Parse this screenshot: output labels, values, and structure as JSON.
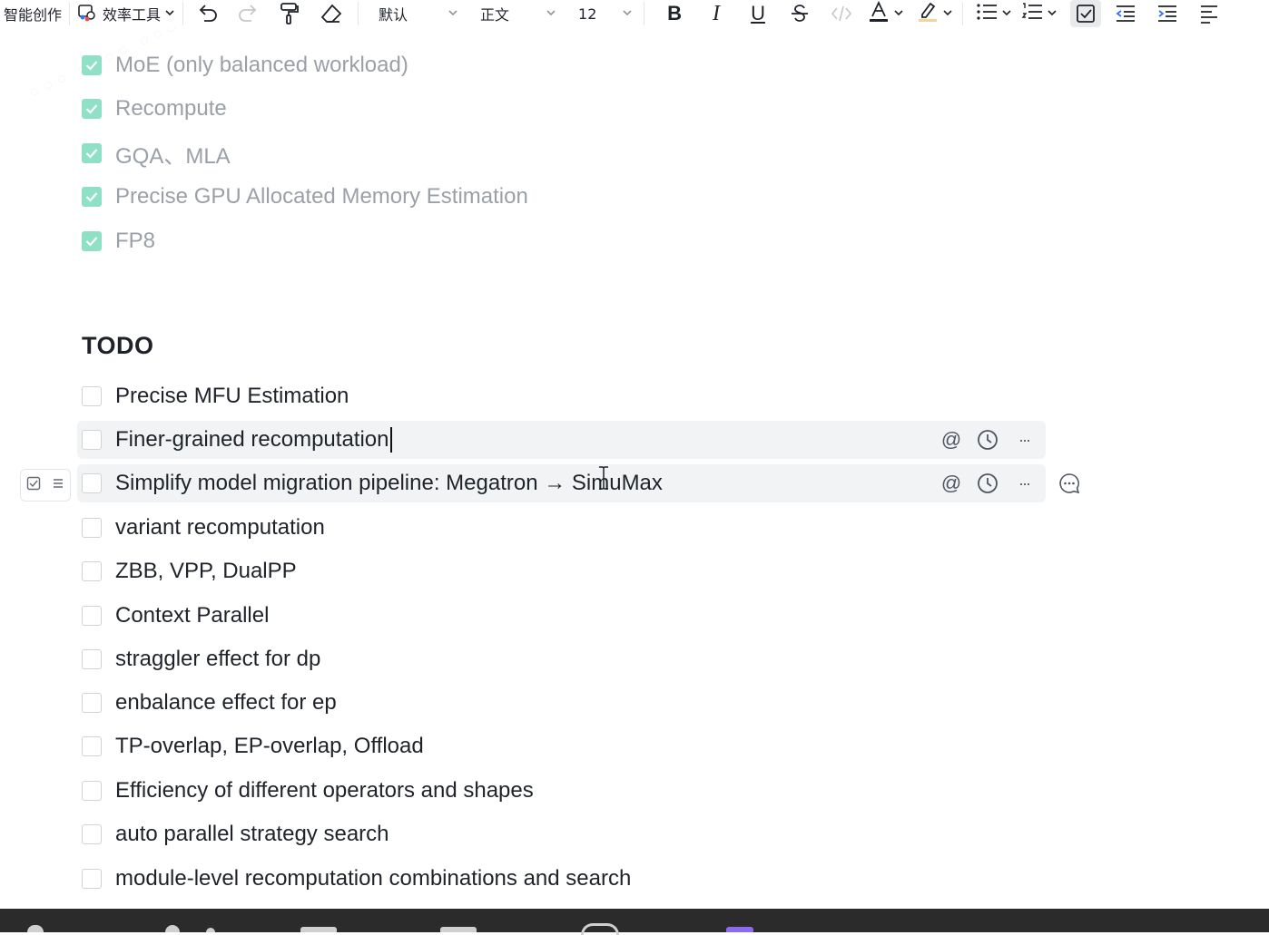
{
  "toolbar": {
    "ai_create": "智能创作",
    "efficiency_tools": "效率工具",
    "font_family": "默认",
    "paragraph_style": "正文",
    "font_size": "12",
    "bold": "B",
    "italic": "I",
    "underline": "U",
    "icons": [
      "undo-icon",
      "redo-icon",
      "format-painter-icon",
      "eraser-icon",
      "strikethrough-icon",
      "code-icon",
      "font-color-icon",
      "highlight-icon",
      "bullet-list-icon",
      "numbered-list-icon",
      "checkbox-list-icon",
      "outdent-icon",
      "indent-icon",
      "align-icon"
    ],
    "accent_color": "#8fe0c4"
  },
  "done_items": [
    {
      "label": "MoE (only balanced workload)"
    },
    {
      "label": "Recompute"
    },
    {
      "label": "GQA、MLA"
    },
    {
      "label": "Precise GPU Allocated Memory Estimation"
    },
    {
      "label": "FP8"
    }
  ],
  "todo": {
    "heading": "TODO",
    "items": [
      {
        "label": "Precise MFU Estimation"
      },
      {
        "label": "Finer-grained recomputation"
      },
      {
        "label": "Simplify model migration pipeline: Megatron → SimuMax"
      },
      {
        "label": "variant recomputation"
      },
      {
        "label": "ZBB, VPP, DualPP"
      },
      {
        "label": "Context Parallel"
      },
      {
        "label": "straggler effect for dp"
      },
      {
        "label": "enbalance effect for ep"
      },
      {
        "label": "TP-overlap, EP-overlap, Offload"
      },
      {
        "label": "Efficiency of different operators and shapes"
      },
      {
        "label": "auto parallel strategy search"
      },
      {
        "label": "module-level recomputation combinations and search"
      }
    ]
  },
  "row_actions": {
    "mention": "@",
    "more": "···"
  }
}
